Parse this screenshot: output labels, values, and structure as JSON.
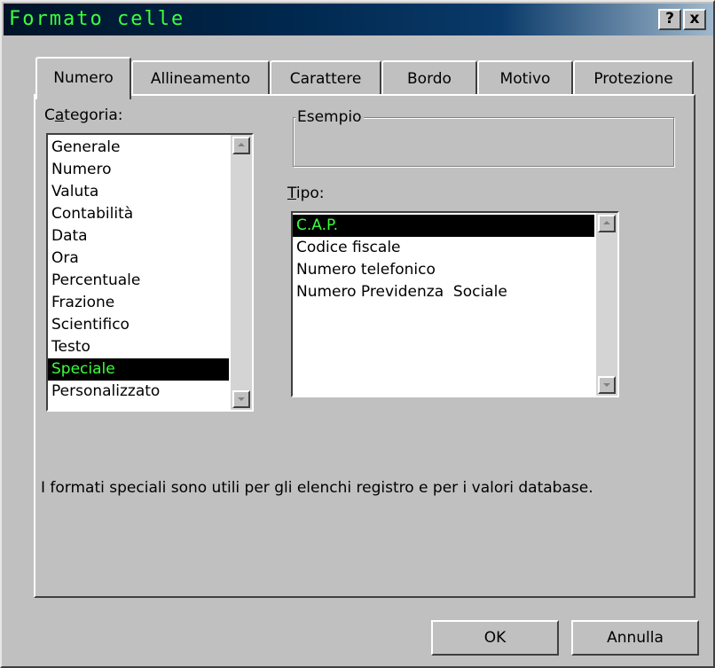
{
  "window": {
    "title": "Formato celle",
    "help_label": "?",
    "close_label": "x",
    "title_color": "#3cff3c"
  },
  "tabs": [
    {
      "label": "Numero",
      "active": true
    },
    {
      "label": "Allineamento",
      "active": false
    },
    {
      "label": "Carattere",
      "active": false
    },
    {
      "label": "Bordo",
      "active": false
    },
    {
      "label": "Motivo",
      "active": false
    },
    {
      "label": "Protezione",
      "active": false
    }
  ],
  "categoria": {
    "label_prefix": "C",
    "label_accel": "a",
    "label_rest": "tegoria:",
    "items": [
      "Generale",
      "Numero",
      "Valuta",
      "Contabilità",
      "Data",
      "Ora",
      "Percentuale",
      "Frazione",
      "Scientifico",
      "Testo",
      "Speciale",
      "Personalizzato"
    ],
    "selected": "Speciale"
  },
  "esempio": {
    "label": "Esempio",
    "value": ""
  },
  "tipo": {
    "label_accel": "T",
    "label_rest": "ipo:",
    "items": [
      "C.A.P.",
      "Codice fiscale",
      "Numero telefonico",
      "Numero Previdenza  Sociale"
    ],
    "selected": "C.A.P."
  },
  "description": "I formati speciali sono utili per gli elenchi registro e per i valori database.",
  "buttons": {
    "ok": "OK",
    "cancel": "Annulla"
  },
  "colors": {
    "face": "#c0c0c0",
    "selection_bg": "#000000",
    "selection_text": "#3cff3c"
  }
}
